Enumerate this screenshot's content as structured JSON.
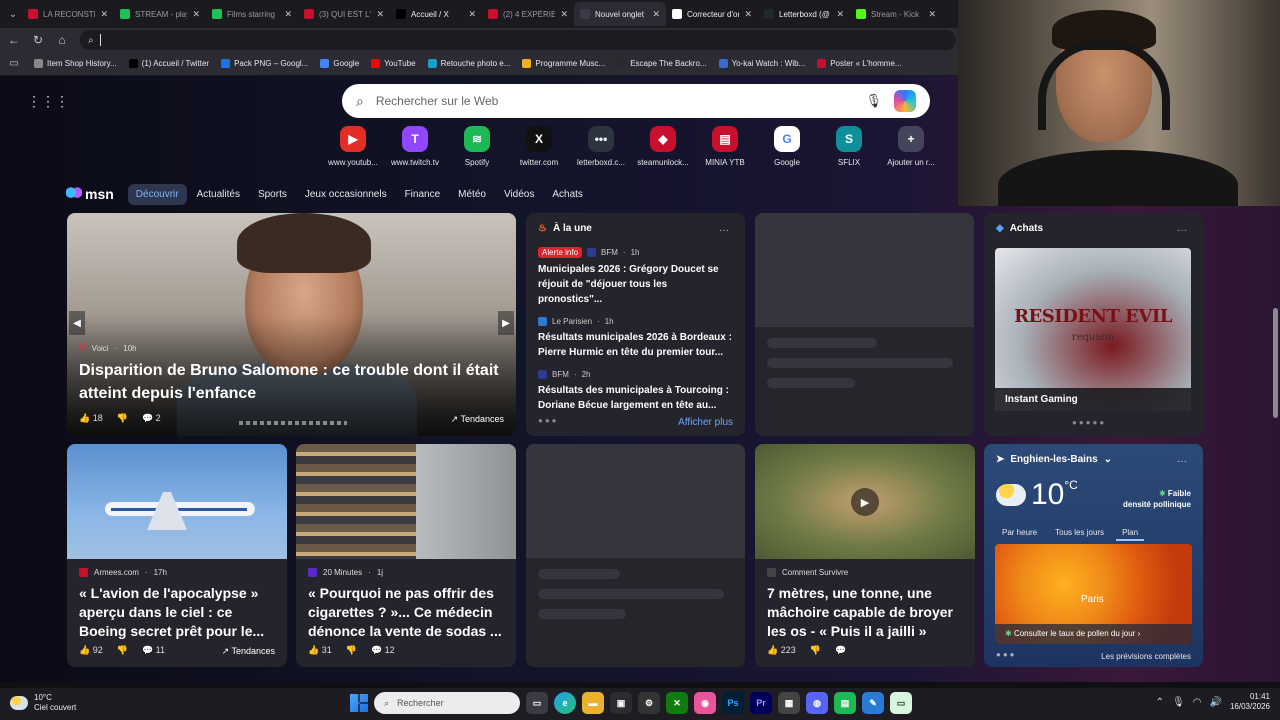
{
  "tabs": [
    {
      "label": "LA RECONSTIT",
      "favicon_color": "#c8102e",
      "active": false
    },
    {
      "label": "STREAM - play",
      "favicon_color": "#20c05a",
      "active": false
    },
    {
      "label": "Films starring",
      "favicon_color": "#20c05a",
      "active": false
    },
    {
      "label": "(3) QUI EST L'",
      "favicon_color": "#c8102e",
      "active": false
    },
    {
      "label": "Accueil / X",
      "favicon_color": "#000000",
      "active": false,
      "bright": true
    },
    {
      "label": "(2) 4 EXPÉRIEN",
      "favicon_color": "#c8102e",
      "active": false
    },
    {
      "label": "Nouvel onglet",
      "favicon_color": "#3a3a48",
      "active": true
    },
    {
      "label": "Correcteur d'or",
      "favicon_color": "#ffffff",
      "active": false,
      "bright": true
    },
    {
      "label": "Letterboxd (@",
      "favicon_color": "#202830",
      "active": false,
      "bright": true
    },
    {
      "label": "Stream - Kick",
      "favicon_color": "#53fc18",
      "active": false
    }
  ],
  "address": {
    "placeholder": ""
  },
  "bookmarks": [
    {
      "label": "Item Shop History...",
      "color": "#888888"
    },
    {
      "label": "(1) Accueil / Twitter",
      "color": "#000000"
    },
    {
      "label": "Pack PNG – Googl...",
      "color": "#1a73e8"
    },
    {
      "label": "Google",
      "color": "#4285f4"
    },
    {
      "label": "YouTube",
      "color": "#ff0000"
    },
    {
      "label": "Retouche photo e...",
      "color": "#18a0c8"
    },
    {
      "label": "Programme Musc...",
      "color": "#f0b020"
    },
    {
      "label": "Escape The Backro...",
      "color": "#2a2a2a"
    },
    {
      "label": "Yo-kai Watch : Wib...",
      "color": "#3a6ad0"
    },
    {
      "label": "Poster « L'homme...",
      "color": "#c8102e"
    }
  ],
  "search": {
    "placeholder": "Rechercher sur le Web"
  },
  "quicklinks": [
    {
      "label": "www.youtub...",
      "glyph": "▶",
      "color": "#e52d27"
    },
    {
      "label": "www.twitch.tv",
      "glyph": "T",
      "color": "#9146ff"
    },
    {
      "label": "Spotify",
      "glyph": "≋",
      "color": "#1db954"
    },
    {
      "label": "twitter.com",
      "glyph": "X",
      "color": "#111111"
    },
    {
      "label": "letterboxd.c...",
      "glyph": "•••",
      "color": "#2c3440"
    },
    {
      "label": "steamunlock...",
      "glyph": "◆",
      "color": "#c8102e"
    },
    {
      "label": "MINIA YTB",
      "glyph": "▤",
      "color": "#c8102e"
    },
    {
      "label": "Google",
      "glyph": "G",
      "color": "#ffffff"
    },
    {
      "label": "SFLIX",
      "glyph": "S",
      "color": "#0f8f9a"
    },
    {
      "label": "Ajouter un r...",
      "glyph": "+",
      "color": "#44445a"
    }
  ],
  "msn": {
    "logo": "msn",
    "nav": [
      "Découvrir",
      "Actualités",
      "Sports",
      "Jeux occasionnels",
      "Finance",
      "Météo",
      "Vidéos",
      "Achats"
    ]
  },
  "hero": {
    "source": "Voici",
    "age": "10h",
    "title": "Disparition de Bruno Salomone : ce trouble dont il était atteint depuis l'enfance",
    "likes": "18",
    "comments": "2",
    "trend": "Tendances"
  },
  "une": {
    "heading": "À la une",
    "items": [
      {
        "badge": "Alerte info",
        "source": "BFM",
        "age": "1h",
        "title": "Municipales 2026 : Grégory Doucet se réjouit de \"déjouer tous les pronostics\"..."
      },
      {
        "badge": "",
        "source": "Le Parisien",
        "age": "1h",
        "title": "Résultats municipales 2026 à Bordeaux : Pierre Hurmic en tête du premier tour..."
      },
      {
        "badge": "",
        "source": "BFM",
        "age": "2h",
        "title": "Résultats des municipales à Tourcoing : Doriane Bécue largement en tête au..."
      }
    ],
    "more": "Afficher plus"
  },
  "achats": {
    "heading": "Achats",
    "poster_title": "RESIDENT EVIL",
    "poster_sub": "requiem",
    "label": "Instant Gaming"
  },
  "cards": [
    {
      "source": "Armees.com",
      "age": "17h",
      "title": "« L'avion de l'apocalypse » aperçu dans le ciel : ce Boeing secret prêt pour le...",
      "likes": "92",
      "comments": "11",
      "trend": "Tendances"
    },
    {
      "source": "20 Minutes",
      "age": "1j",
      "title": "« Pourquoi ne pas offrir des cigarettes ? »... Ce médecin dénonce la vente de sodas ...",
      "likes": "31",
      "comments": "12",
      "trend": ""
    },
    {
      "source": "Comment Survivre",
      "age": "",
      "title": "7 mètres, une tonne, une mâchoire capable de broyer les os - « Puis il a jailli »",
      "likes": "223",
      "comments": "",
      "trend": ""
    }
  ],
  "weather": {
    "location": "Enghien-les-Bains",
    "temp": "10",
    "unit": "°C",
    "pollen_level": "Faible",
    "pollen_label": "densité pollinique",
    "tabs": [
      "Par heure",
      "Tous les jours",
      "Plan"
    ],
    "city": "Paris",
    "cta": "Consulter le taux de pollen du jour",
    "forecast": "Les prévisions complètes"
  },
  "taskbar": {
    "temp": "10°C",
    "condition": "Ciel couvert",
    "search": "Rechercher",
    "time": "01:41",
    "date": "16/03/2026"
  }
}
